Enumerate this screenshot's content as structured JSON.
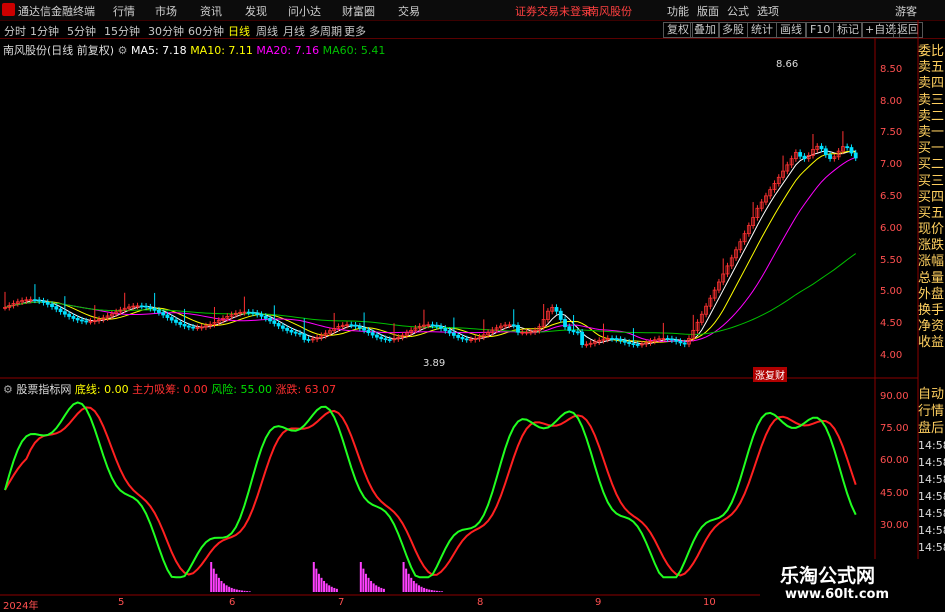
{
  "menubar": {
    "app_title": "通达信金融终端",
    "menus": [
      "行情",
      "市场",
      "资讯",
      "发现",
      "问小达",
      "财富圈",
      "交易"
    ],
    "warning": "证券交易未登录",
    "stock_name": "南风股份",
    "right_menus": [
      "功能",
      "版面",
      "公式",
      "选项"
    ],
    "guest": "游客"
  },
  "toolbar": {
    "periods": [
      "分时",
      "1分钟",
      "5分钟",
      "15分钟",
      "30分钟",
      "60分钟",
      "日线",
      "周线",
      "月线",
      "多周期",
      "更多"
    ],
    "active": "日线",
    "buttons": [
      "复权",
      "叠加",
      "多股",
      "统计",
      "画线",
      "F10",
      "标记",
      "+自选",
      "返回"
    ]
  },
  "main_chart": {
    "title": "南风股份(日线 前复权)",
    "ma5": "MA5: 7.18",
    "ma10": "MA10: 7.11",
    "ma20": "MA20: 7.16",
    "ma60": "MA60: 5.41",
    "high_label": "8.66",
    "low_label": "3.89",
    "badge": "涨复财",
    "y_ticks": [
      "8.50",
      "8.00",
      "7.50",
      "7.00",
      "6.50",
      "6.00",
      "5.50",
      "5.00",
      "4.50",
      "4.00"
    ]
  },
  "indicator": {
    "name": "股票指标网",
    "l1": "底线: 0.00",
    "l2": "主力吸筹: 0.00",
    "l3": "风险: 55.00",
    "l4": "涨跌: 63.07",
    "y_ticks": [
      "90.00",
      "75.00",
      "60.00",
      "45.00",
      "30.00"
    ]
  },
  "x_axis": [
    "2024年",
    "5",
    "6",
    "7",
    "8",
    "9",
    "10"
  ],
  "sidebar_top": [
    "委比",
    "卖五",
    "卖四",
    "卖三",
    "卖二",
    "卖一",
    "买一",
    "买二",
    "买三",
    "买四",
    "买五",
    "现价",
    "涨跌",
    "涨幅",
    "总量",
    "外盘",
    "换手",
    "净资",
    "收益"
  ],
  "sidebar_bottom": [
    "自动",
    "行情",
    "盘后",
    "14:58",
    "14:58",
    "14:58",
    "14:58",
    "14:58",
    "14:58",
    "14:58",
    "14:58",
    "14:58"
  ],
  "watermark": {
    "title": "乐淘公式网",
    "url": "www.60lt.com"
  },
  "colors": {
    "up": "#ff3232",
    "down": "#00e0ff",
    "ma5": "#ffffff",
    "ma10": "#ffff00",
    "ma20": "#ff00ff",
    "ma60": "#00c000",
    "bg": "#000000"
  }
}
